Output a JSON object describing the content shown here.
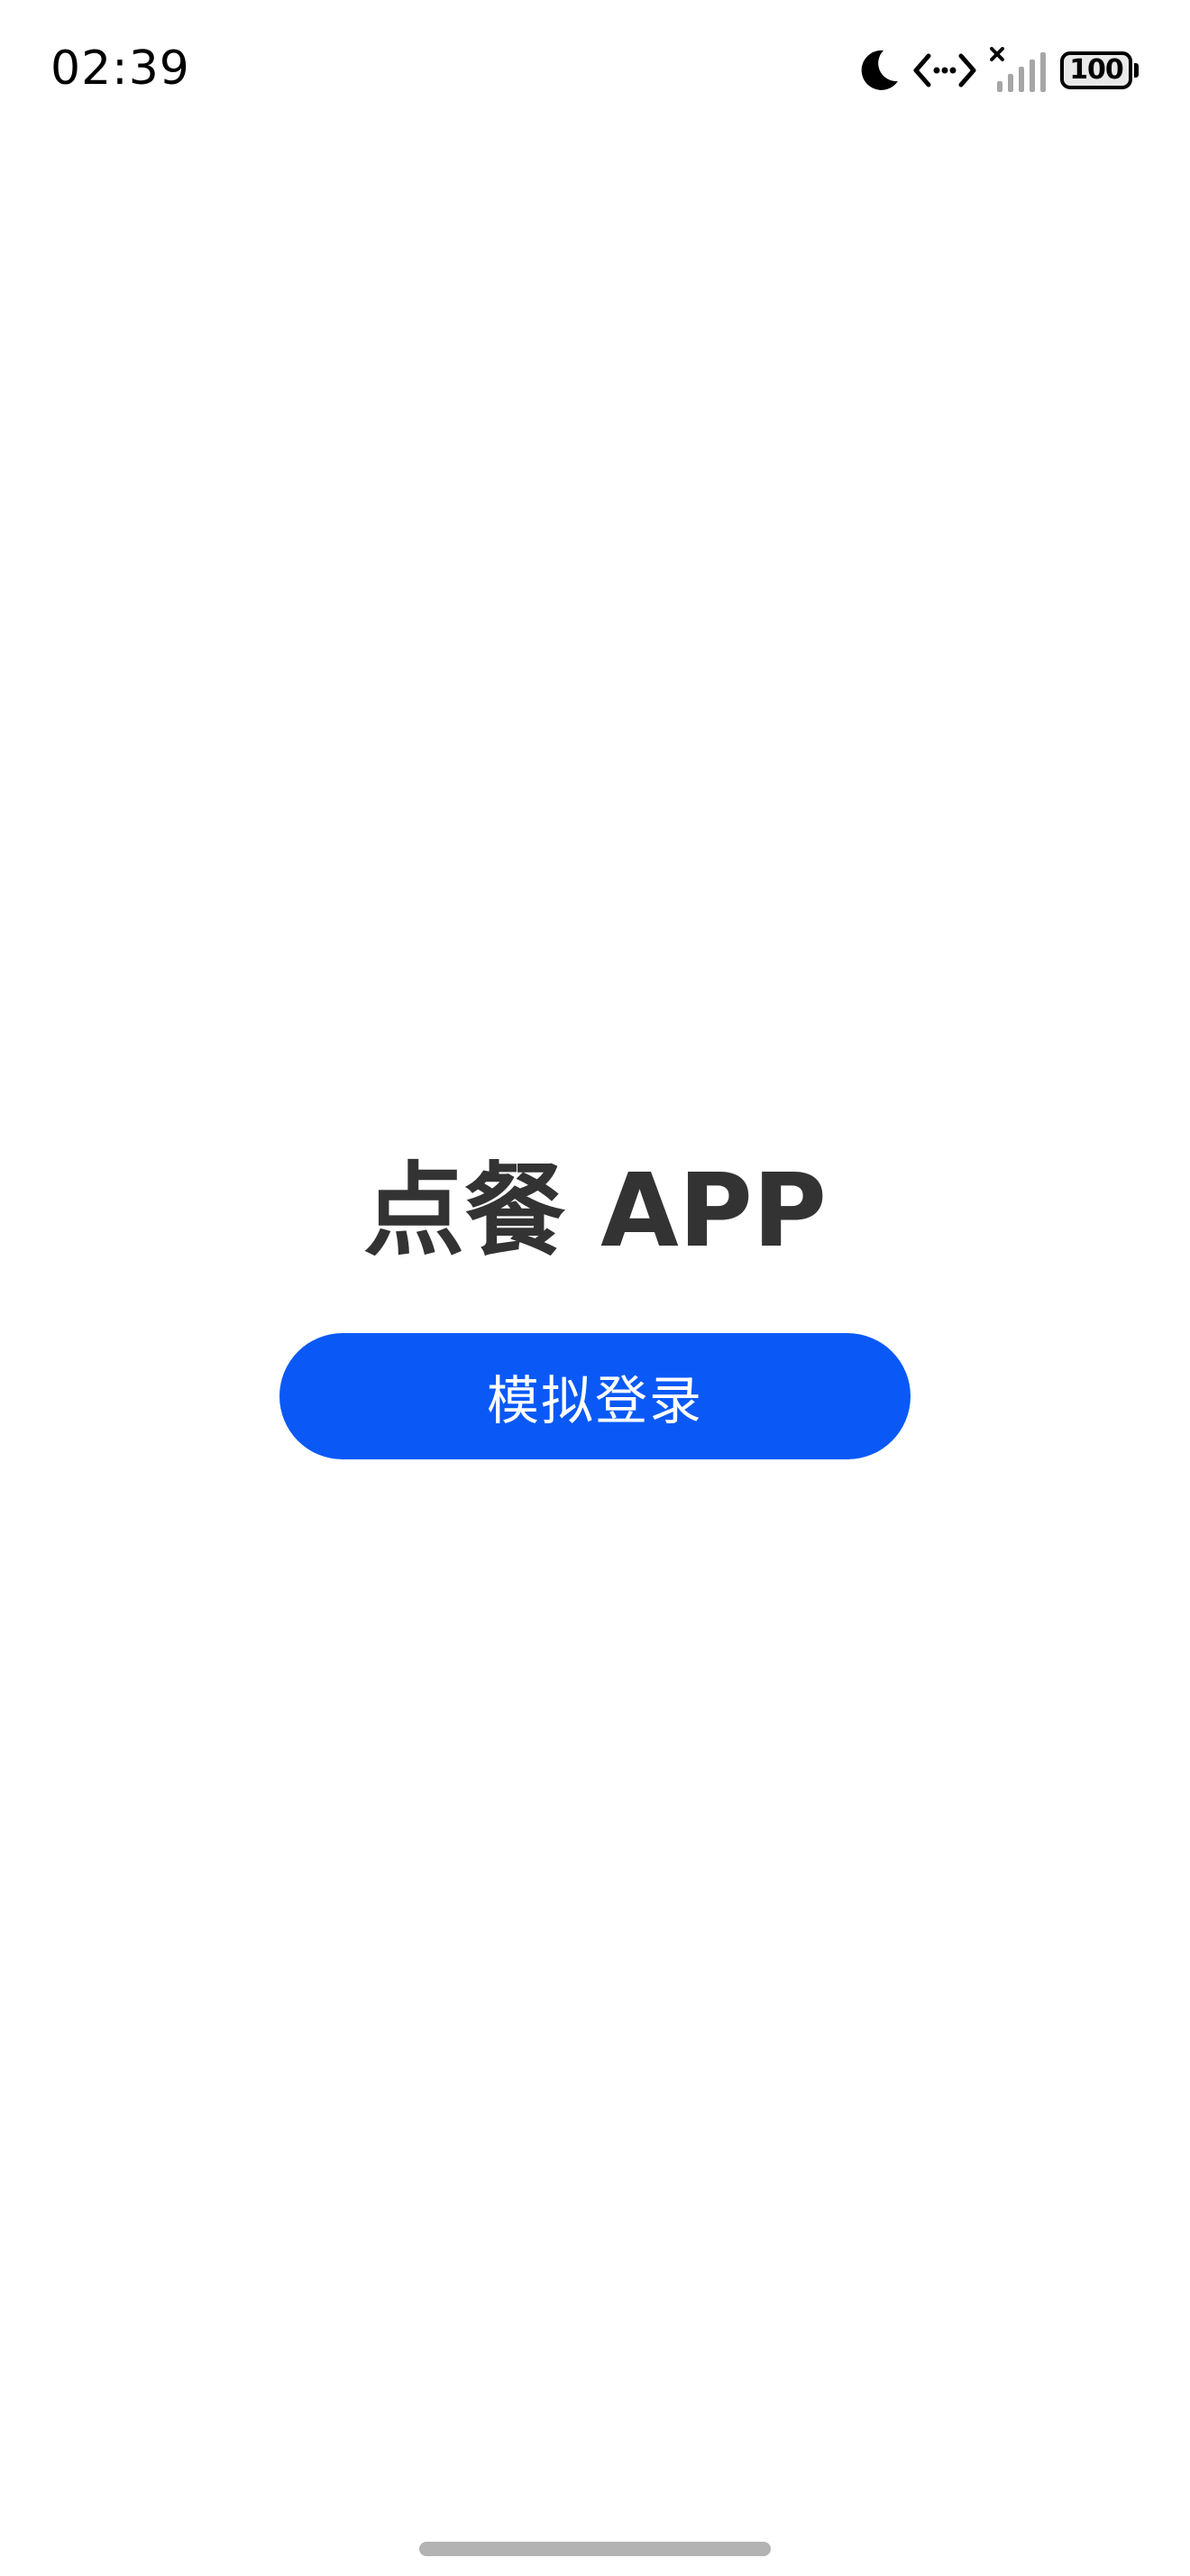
{
  "status_bar": {
    "time": "02:39",
    "battery_level": "100",
    "icons": [
      "moon-icon",
      "data-transfer-icon",
      "no-signal-icon",
      "battery-icon"
    ]
  },
  "main": {
    "title": "点餐 APP",
    "login_button_label": "模拟登录"
  },
  "colors": {
    "primary": "#0a59f7",
    "title_text": "#333333",
    "background": "#ffffff",
    "home_indicator": "#b3b3b3"
  }
}
